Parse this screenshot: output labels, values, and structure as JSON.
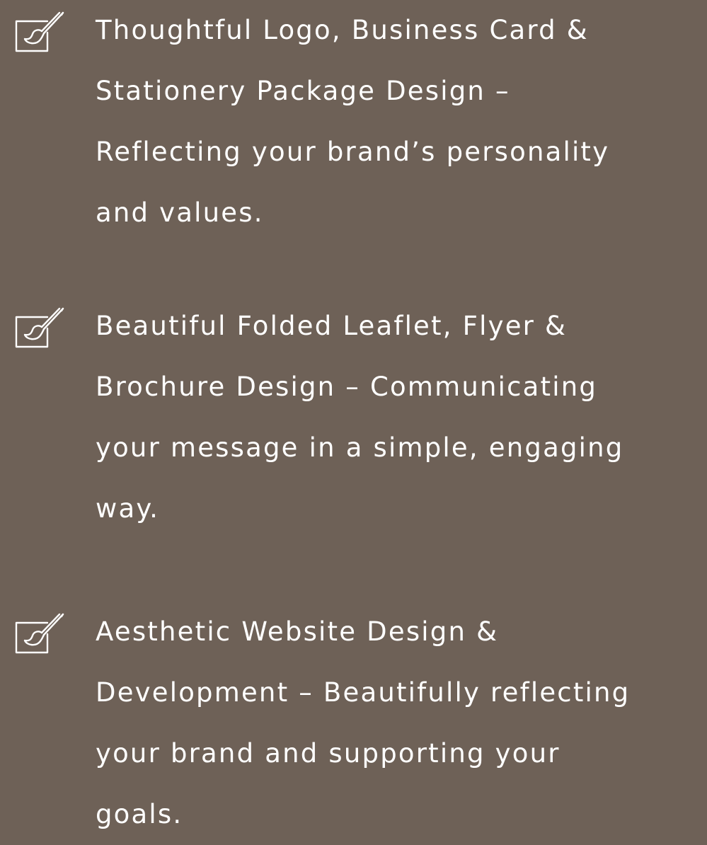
{
  "colors": {
    "background": "#6e6157",
    "text": "#ffffff",
    "icon_stroke": "#ffffff"
  },
  "services": [
    {
      "icon": "paint-brush-icon",
      "lines": [
        "Thoughtful Logo, Business Card &",
        "Stationery Package Design –",
        "Reflecting your brand’s personality",
        "and values."
      ]
    },
    {
      "icon": "paint-brush-icon",
      "lines": [
        "Beautiful Folded Leaflet, Flyer &",
        "Brochure Design – Communicating",
        "your message in a simple, engaging",
        "way."
      ]
    },
    {
      "icon": "paint-brush-icon",
      "lines": [
        "Aesthetic Website Design &",
        "Development – Beautifully reflecting",
        "your brand and supporting your",
        "goals."
      ]
    }
  ]
}
